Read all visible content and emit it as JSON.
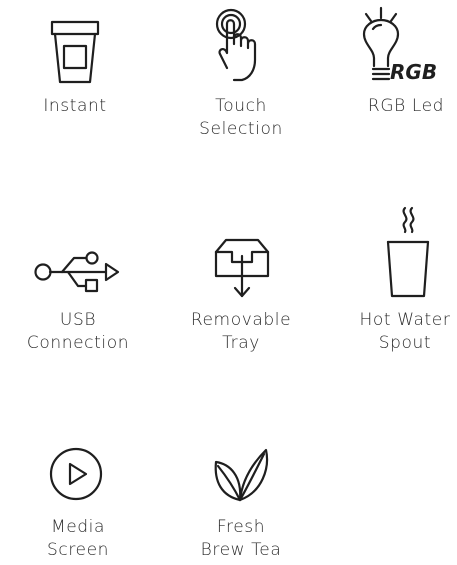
{
  "features": [
    {
      "id": "instant",
      "icon": "cup-icon",
      "label": [
        "Instant"
      ]
    },
    {
      "id": "touch-selection",
      "icon": "touch-hand-icon",
      "label": [
        "Touch",
        "Selection"
      ]
    },
    {
      "id": "rgb-led",
      "icon": "lightbulb-rgb-icon",
      "icon_text": "RGB",
      "label": [
        "RGB Led"
      ]
    },
    {
      "id": "usb-connection",
      "icon": "usb-icon",
      "label": [
        "USB",
        "Connection"
      ]
    },
    {
      "id": "removable-tray",
      "icon": "tray-icon",
      "label": [
        "Removable",
        "Tray"
      ]
    },
    {
      "id": "hot-water-spout",
      "icon": "hot-cup-icon",
      "label": [
        "Hot Water",
        "Spout"
      ]
    },
    {
      "id": "media-screen",
      "icon": "play-icon",
      "label": [
        "Media",
        "Screen"
      ]
    },
    {
      "id": "fresh-brew-tea",
      "icon": "tea-leaves-icon",
      "label": [
        "Fresh",
        "Brew Tea"
      ]
    }
  ],
  "colors": {
    "icon": "#1f1f1f",
    "text": "#2a2a2a",
    "background": "#ffffff"
  }
}
